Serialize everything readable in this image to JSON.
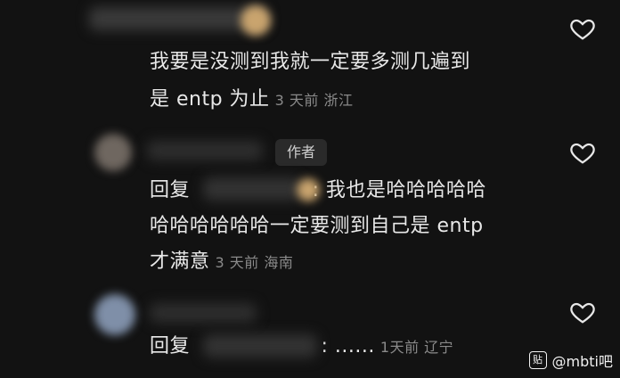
{
  "comments": [
    {
      "lines": [
        "我要是没测到我就一定要多测几遍到",
        "是 entp 为止"
      ],
      "time": "3 天前",
      "location": "浙江"
    },
    {
      "badge": "作者",
      "reply_label": "回复",
      "lines": [
        ": 我也是哈哈哈哈哈",
        "哈哈哈哈哈哈一定要测到自己是 entp",
        "才满意"
      ],
      "time": "3 天前",
      "location": "海南"
    },
    {
      "reply_label": "回复",
      "lines": [
        ": ......"
      ],
      "time": "1天前",
      "location": "辽宁"
    }
  ],
  "watermark": {
    "logo_text": "贴",
    "text": "@mbti吧"
  },
  "icons": {
    "like": "heart-outline-icon"
  }
}
